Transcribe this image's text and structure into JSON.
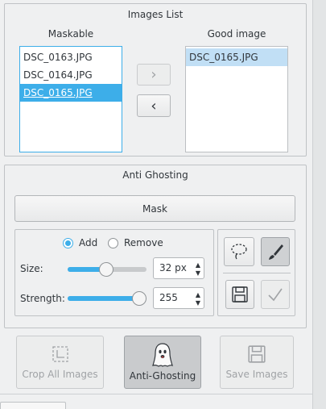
{
  "images_list": {
    "title": "Images List",
    "maskable_label": "Maskable",
    "good_label": "Good image",
    "maskable_items": [
      "DSC_0163.JPG",
      "DSC_0164.JPG",
      "DSC_0165.JPG"
    ],
    "maskable_selected": "DSC_0165.JPG",
    "good_items": [
      "DSC_0165.JPG"
    ],
    "move_right_glyph": "›",
    "move_left_glyph": "‹"
  },
  "anti_ghosting": {
    "title": "Anti Ghosting",
    "mask_button": "Mask",
    "mode_add": "Add",
    "mode_remove": "Remove",
    "mode_selected": "Add",
    "size_label": "Size:",
    "size_value": "32 px",
    "size_fraction": 0.49,
    "strength_label": "Strength:",
    "strength_value": "255",
    "strength_fraction": 1.0
  },
  "actions": {
    "crop_all": "Crop All Images",
    "anti_ghosting": "Anti-Ghosting",
    "save_images": "Save Images"
  },
  "colors": {
    "accent": "#3daee9",
    "background": "#eff0f1"
  }
}
